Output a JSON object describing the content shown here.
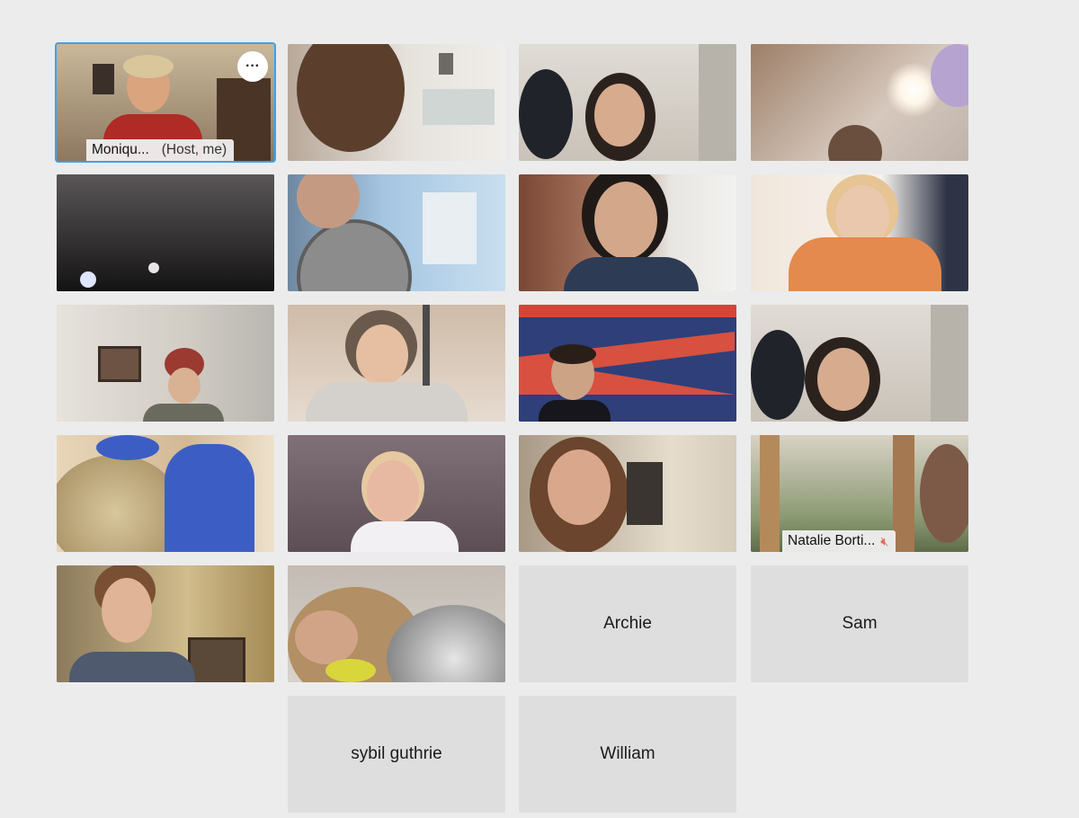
{
  "participants": [
    {
      "name": "Moniqu...",
      "role": "(Host, me)",
      "type": "video",
      "host": true
    },
    {
      "type": "video"
    },
    {
      "type": "video"
    },
    {
      "type": "video"
    },
    {
      "type": "video"
    },
    {
      "type": "video"
    },
    {
      "type": "video"
    },
    {
      "type": "video"
    },
    {
      "type": "video"
    },
    {
      "type": "video"
    },
    {
      "type": "video"
    },
    {
      "type": "video"
    },
    {
      "type": "video"
    },
    {
      "type": "video"
    },
    {
      "type": "video"
    },
    {
      "name": "Natalie Borti...",
      "type": "video",
      "muted": true
    },
    {
      "type": "video"
    },
    {
      "type": "video"
    },
    {
      "name": "Archie",
      "type": "empty"
    },
    {
      "name": "Sam",
      "type": "empty"
    },
    {
      "name": "sybil guthrie",
      "type": "empty"
    },
    {
      "name": "William",
      "type": "empty"
    }
  ],
  "host_menu": {
    "more_label": "···"
  },
  "icons": {
    "mute": "mic-muted-icon",
    "more": "more-options-icon"
  },
  "colors": {
    "host_border": "#3aa3f0",
    "mute": "#e06a52",
    "background": "#ececec",
    "empty_tile": "#dedede"
  }
}
